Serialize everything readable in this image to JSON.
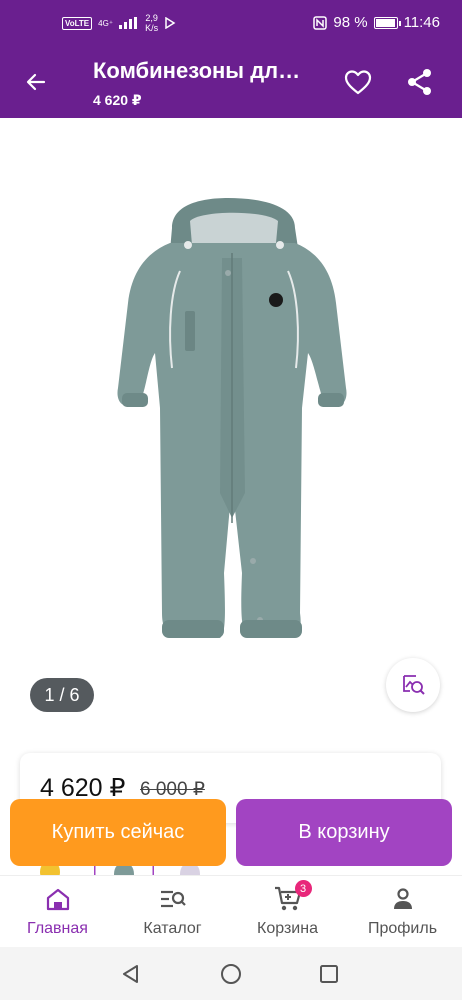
{
  "status_bar": {
    "volte": "VoLTE",
    "network": "4G⁺",
    "speed_value": "2,9",
    "speed_unit": "K/s",
    "battery_percent": "98 %",
    "battery_level": 0.98,
    "time": "11:46"
  },
  "header": {
    "title": "Комбинезоны дл…",
    "price": "4 620 ₽"
  },
  "gallery": {
    "pager": "1 / 6",
    "current_index": 1,
    "total": 6
  },
  "price_card": {
    "current_price": "4 620 ₽",
    "old_price": "6 000 ₽"
  },
  "actions": {
    "buy_now_label": "Купить сейчас",
    "add_to_cart_label": "В корзину"
  },
  "bottom_nav": {
    "items": [
      {
        "label": "Главная",
        "icon": "home-icon",
        "active": true
      },
      {
        "label": "Каталог",
        "icon": "catalog-icon",
        "active": false
      },
      {
        "label": "Корзина",
        "icon": "cart-icon",
        "active": false,
        "badge": "3"
      },
      {
        "label": "Профиль",
        "icon": "profile-icon",
        "active": false
      }
    ]
  },
  "colors": {
    "brand": "#6a1f8f",
    "buy_now": "#ff9a1e",
    "add_to_cart": "#a244c2",
    "active_nav": "#8a2fb0",
    "badge": "#e8277a",
    "garment": "#7e9a98"
  }
}
